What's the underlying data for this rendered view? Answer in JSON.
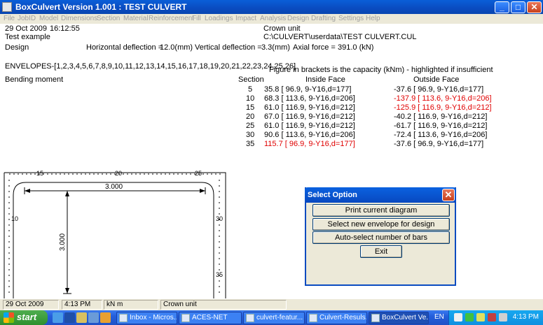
{
  "window": {
    "title": "BoxCulvert Version 1.001 : TEST CULVERT"
  },
  "menu": [
    "File",
    "JobID",
    "Model",
    "Dimensions",
    "Section",
    "Material",
    "Reinforcement",
    "Fill",
    "Loadings",
    "Impact",
    "Analysis",
    "Design",
    "Drafting",
    "Settings",
    "Help"
  ],
  "header": {
    "date": "29 Oct 2009",
    "time": "16:12:55",
    "title": "Test example",
    "design_label": "Design",
    "hdefl_label": "Horizontal deflection =",
    "hdefl_value": "12.0(mm)",
    "vdefl_label": "Vertical deflection =",
    "vdefl_value": "3.3(mm)",
    "axial_label": "Axial force =",
    "axial_value": "391.0 (kN)",
    "unit": "Crown unit",
    "path": "C:\\CULVERT\\userdata\\TEST CULVERT.CUL"
  },
  "envelopes": "ENVELOPES-[1,2,3,4,5,6,7,8,9,10,11,12,13,14,15,16,17,18,19,20,21,22,23,24,25,26]",
  "capacity_note": "Figure in brackets is the capacity (kNm) - highlighted if insufficient",
  "table": {
    "label": "Bending moment",
    "headers": {
      "section": "Section",
      "inside": "Inside Face",
      "outside": "Outside Face"
    },
    "rows": [
      {
        "section": "5",
        "inside": "35.8 [ 96.9, 9-Y16,d=177]",
        "inside_red": false,
        "outside": "-37.6 [ 96.9, 9-Y16,d=177]",
        "outside_red": false
      },
      {
        "section": "10",
        "inside": "68.3 [ 113.6, 9-Y16,d=206]",
        "inside_red": false,
        "outside": "-137.9 [ 113.6, 9-Y16,d=206]",
        "outside_red": true
      },
      {
        "section": "15",
        "inside": "61.0 [ 116.9, 9-Y16,d=212]",
        "inside_red": false,
        "outside": "-125.9 [ 116.9, 9-Y16,d=212]",
        "outside_red": true
      },
      {
        "section": "20",
        "inside": "67.0 [ 116.9, 9-Y16,d=212]",
        "inside_red": false,
        "outside": "-40.2 [ 116.9, 9-Y16,d=212]",
        "outside_red": false
      },
      {
        "section": "25",
        "inside": "61.0 [ 116.9, 9-Y16,d=212]",
        "inside_red": false,
        "outside": "-61.7 [ 116.9, 9-Y16,d=212]",
        "outside_red": false
      },
      {
        "section": "30",
        "inside": "90.6 [ 113.6, 9-Y16,d=206]",
        "inside_red": false,
        "outside": "-72.4 [ 113.6, 9-Y16,d=206]",
        "outside_red": false
      },
      {
        "section": "35",
        "inside": "115.7 [ 96.9, 9-Y16,d=177]",
        "inside_red": true,
        "outside": "-37.6 [ 96.9, 9-Y16,d=177]",
        "outside_red": false
      }
    ]
  },
  "diagram": {
    "span": "3.000",
    "height": "3.000",
    "labels": [
      "15",
      "20",
      "25",
      "10",
      "30",
      "35"
    ]
  },
  "dialog": {
    "title": "Select Option",
    "buttons": [
      "Print current diagram",
      "Select new envelope for design",
      "Auto-select number of bars",
      "Exit"
    ]
  },
  "status": {
    "date": "29 Oct 2009",
    "time": "4:13 PM",
    "units": "kN m",
    "unit": "Crown unit"
  },
  "taskbar": {
    "start": "start",
    "tasks": [
      "Inbox - Micros...",
      "ACES-NET",
      "culvert-featur...",
      "Culvert-Resuls...",
      "BoxCulvert Ve..."
    ],
    "lang": "EN",
    "clock": "4:13 PM"
  },
  "colors": {
    "title_blue": "#0a4bc0",
    "highlight_red": "#e00000",
    "start_green": "#3a9a3a"
  }
}
